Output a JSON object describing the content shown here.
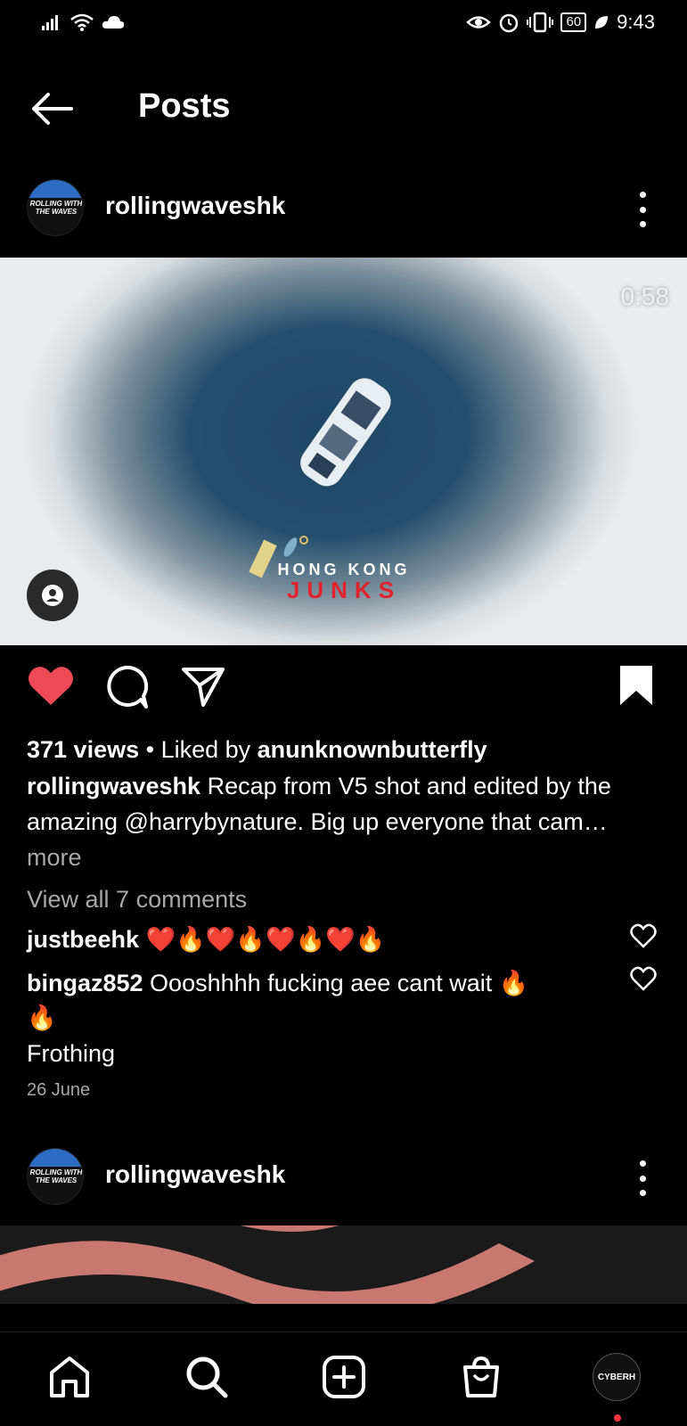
{
  "status": {
    "battery": "60",
    "time": "9:43"
  },
  "header": {
    "title": "Posts"
  },
  "post1": {
    "username": "rollingwaveshk",
    "avatar_text": "ROLLING WITH THE WAVES",
    "duration": "0:58",
    "media_logo_top": "HONG KONG",
    "media_logo_bottom": "JUNKS",
    "views": "371 views",
    "liked_prefix": " • Liked by ",
    "liked_by": "anunknownbutterfly",
    "caption_user": "rollingwaveshk",
    "caption_text": " Recap from V5 shot and edited by the amazing @harrybynature. Big up everyone that cam…",
    "more_label": "more",
    "view_comments": "View all 7 comments",
    "comments": [
      {
        "user": "justbeehk",
        "text": " ❤️🔥❤️🔥❤️🔥❤️🔥"
      },
      {
        "user": "bingaz852",
        "text": " Oooshhhh fucking aee cant wait 🔥",
        "text2": "🔥",
        "text3": " Frothing"
      }
    ],
    "date": "26 June"
  },
  "post2": {
    "username": "rollingwaveshk",
    "avatar_text": "ROLLING WITH THE WAVES"
  },
  "nav": {
    "profile_label": "CYBERH"
  },
  "colors": {
    "like": "#ed4956",
    "background": "#000000",
    "muted": "#a8a8a8"
  }
}
